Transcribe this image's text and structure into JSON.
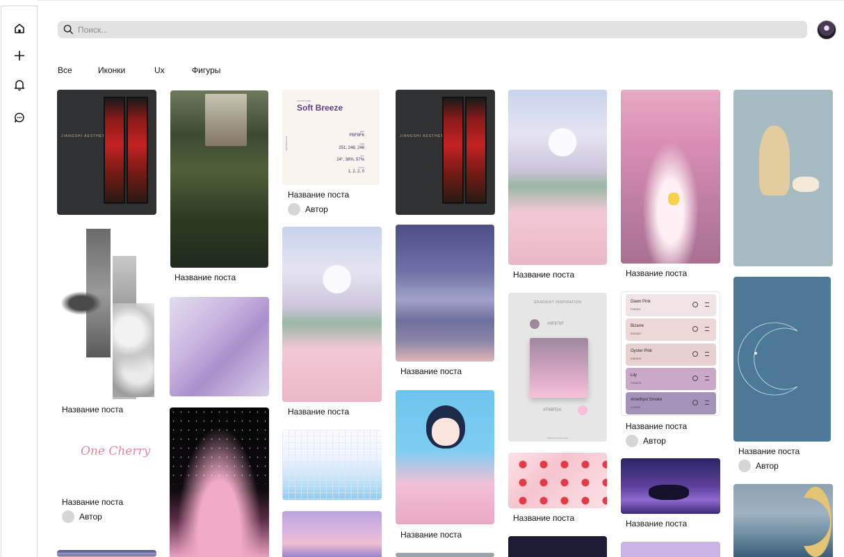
{
  "nav": {
    "items": [
      {
        "name": "home",
        "icon": "home-icon"
      },
      {
        "name": "create",
        "icon": "plus-icon"
      },
      {
        "name": "notifications",
        "icon": "bell-icon"
      },
      {
        "name": "messages",
        "icon": "chat-bubble-icon"
      }
    ]
  },
  "search": {
    "placeholder": "Поиск..."
  },
  "filters": [
    "Все",
    "Иконки",
    "Ux",
    "Фигуры"
  ],
  "posts": {
    "caption": "Название поста",
    "author": "Автор"
  },
  "tiles": {
    "jiangshi_title": "JIANGSHI AESTHETIC",
    "soft_breeze": {
      "label": "COLOR NAME",
      "name": "Soft Breeze",
      "hex_label": "HEX",
      "hex": "FBF8F6",
      "rgb_label": "RGB",
      "rgb": "251, 248, 246",
      "hsl_label": "HSL",
      "hsl": "24°, 38%, 97%",
      "cmyk_label": "CMYK",
      "cmyk": "1, 2, 2, 0",
      "side": "ANNASCOLOR"
    },
    "one_cherry": "One Cherry",
    "gradient": {
      "title": "GRADIENT INSPIRATION",
      "hex1": "#9F879F",
      "hex2": "#F9BFDA",
      "footer": "WWW.COLORS.COM"
    },
    "palette": [
      {
        "name": "Dawn Pink",
        "hex": "F0E4E4",
        "color": "#f0e4e4"
      },
      {
        "name": "Bizarre",
        "hex": "EDD8D7",
        "color": "#edd8d7"
      },
      {
        "name": "Oyster Pink",
        "hex": "E8D0D0",
        "color": "#e8d0d0"
      },
      {
        "name": "Lily",
        "hex": "C9A8C8",
        "color": "#c9a8c8"
      },
      {
        "name": "Amethyst Smoke",
        "hex": "A493B9",
        "color": "#a493b9"
      }
    ]
  }
}
